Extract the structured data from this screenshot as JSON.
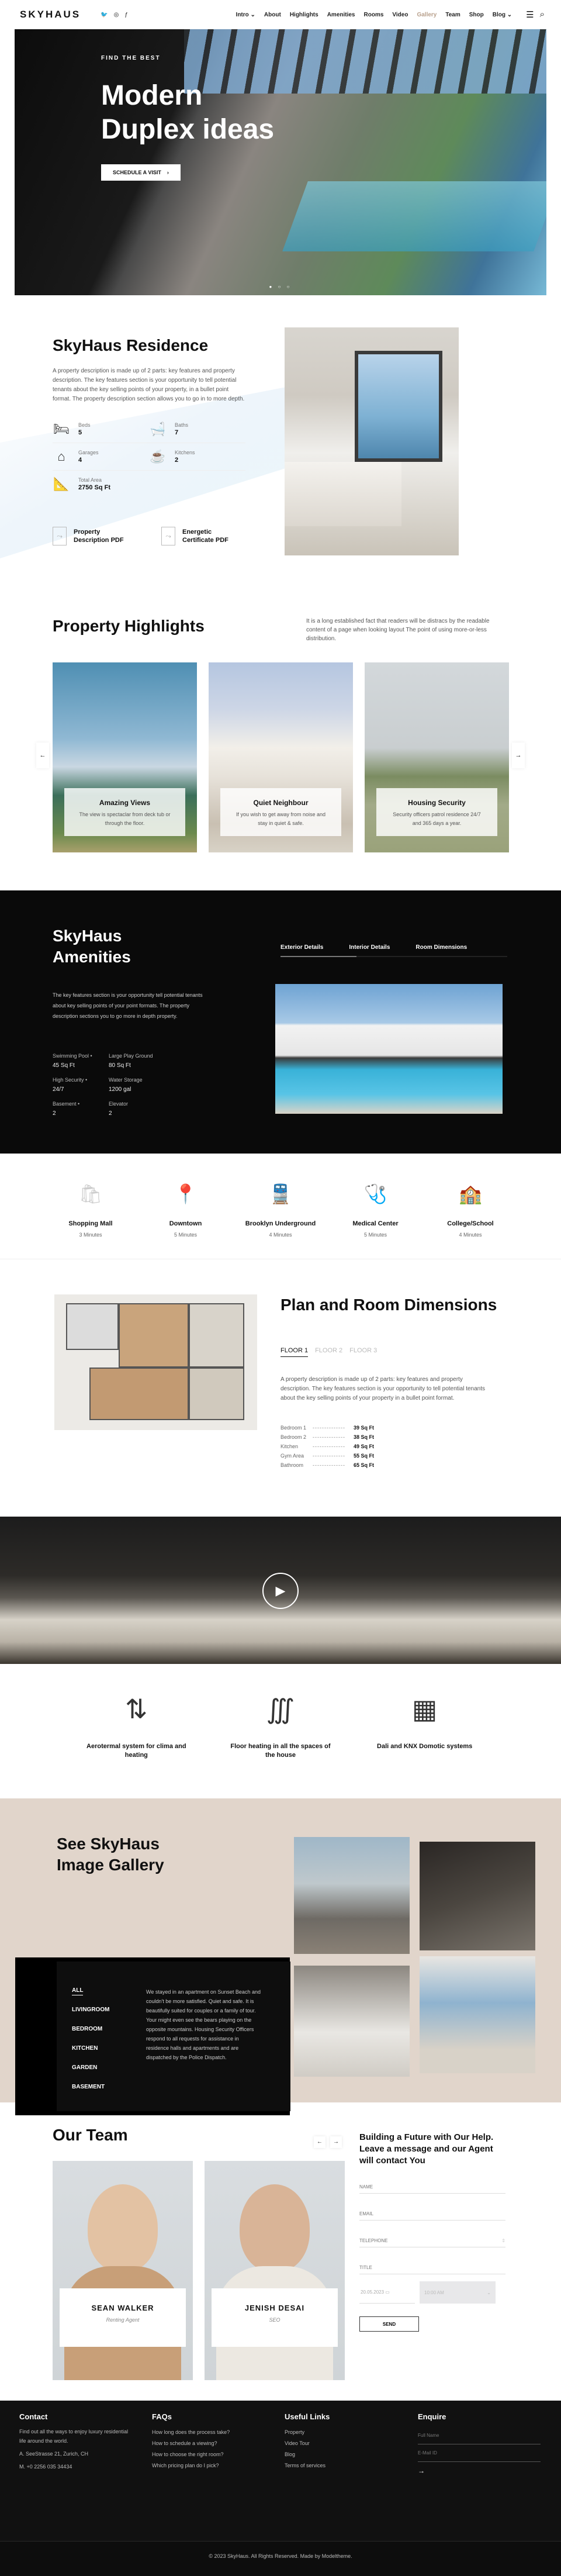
{
  "header": {
    "logo": "SKYHAUS",
    "social": [
      "twitter-icon",
      "instagram-icon",
      "facebook-icon"
    ],
    "nav": [
      {
        "label": "Intro ⌄",
        "active": false
      },
      {
        "label": "About",
        "active": false
      },
      {
        "label": "Highlights",
        "active": false
      },
      {
        "label": "Amenities",
        "active": false
      },
      {
        "label": "Rooms",
        "active": false
      },
      {
        "label": "Video",
        "active": false
      },
      {
        "label": "Gallery",
        "active": true
      },
      {
        "label": "Team",
        "active": false
      },
      {
        "label": "Shop",
        "active": false
      },
      {
        "label": "Blog ⌄",
        "active": false
      }
    ],
    "menu_icon": "☰",
    "search_icon": "⌕"
  },
  "hero": {
    "kicker": "FIND THE BEST",
    "title_line1": "Modern",
    "title_line2": "Duplex ideas",
    "cta": "SCHEDULE A VISIT",
    "cta_arrow": "›",
    "dots": "● ○ ○"
  },
  "residence": {
    "title": "SkyHaus Residence",
    "description": "A property description is made up of 2 parts: key features and property description. The key features section is your opportunity to tell potential tenants about the key selling points of your property, in a bullet point format. The property description section allows you to go in to more depth.",
    "specs": [
      {
        "label": "Beds",
        "value": "5",
        "icon": "🛏"
      },
      {
        "label": "Baths",
        "value": "7",
        "icon": "🛁"
      },
      {
        "label": "Garages",
        "value": "4",
        "icon": "⌂"
      },
      {
        "label": "Kitchens",
        "value": "2",
        "icon": "☕"
      },
      {
        "label": "Total Area",
        "value": "2750 Sq Ft",
        "icon": "📐"
      }
    ],
    "pdfs": [
      {
        "label": "Property Description PDF"
      },
      {
        "label": "Energetic Certificate PDF"
      }
    ]
  },
  "highlights": {
    "title": "Property Highlights",
    "description": "It is a long established fact that readers will be distracs by the readable content of a page when looking layout The point of using more-or-less distribution.",
    "cards": [
      {
        "title": "Amazing Views",
        "text": "The view is spectaclar from deck tub or through the floor."
      },
      {
        "title": "Quiet Neighbour",
        "text": "If you wish to get away from noise and stay in quiet & safe."
      },
      {
        "title": "Housing Security",
        "text": "Security officers patrol residence 24/7 and 365 days a year."
      }
    ],
    "prev": "←",
    "next": "→"
  },
  "amenities": {
    "title": "SkyHaus Amenities",
    "description": "The key features section is your opportunity tell potential tenants about key selling points of your point formats. The property description sections you to go more in depth property.",
    "items": [
      {
        "label": "Swimming Pool •",
        "value": "45 Sq Ft"
      },
      {
        "label": "Large Play Ground",
        "value": "80 Sq Ft"
      },
      {
        "label": "High Security •",
        "value": "24/7"
      },
      {
        "label": "Water Storage",
        "value": "1200 gal"
      },
      {
        "label": "Basement •",
        "value": "2"
      },
      {
        "label": "Elevator",
        "value": "2"
      }
    ],
    "tabs": [
      "Exterior Details",
      "Interior Details",
      "Room Dimensions"
    ],
    "active_tab": "Exterior Details"
  },
  "nearby": [
    {
      "title": "Shopping Mall",
      "time": "3 Minutes",
      "icon": "🛍"
    },
    {
      "title": "Downtown",
      "time": "5 Minutes",
      "icon": "📍"
    },
    {
      "title": "Brooklyn Underground",
      "time": "4 Minutes",
      "icon": "🚆"
    },
    {
      "title": "Medical Center",
      "time": "5 Minutes",
      "icon": "🩺"
    },
    {
      "title": "College/School",
      "time": "4 Minutes",
      "icon": "🏫"
    }
  ],
  "plan": {
    "title": "Plan and Room Dimensions",
    "floors": [
      "FLOOR 1",
      "FLOOR 2",
      "FLOOR 3"
    ],
    "active_floor": "FLOOR 1",
    "description": "A property description is made up of 2 parts: key features and property description. The key features section is your opportunity to tell potential tenants about the key selling points of your property in a bullet point format.",
    "rooms": [
      {
        "name": "Bedroom 1",
        "value": "39 Sq Ft"
      },
      {
        "name": "Bedroom 2",
        "value": "38 Sq Ft"
      },
      {
        "name": "Kitchen",
        "value": "49 Sq Ft"
      },
      {
        "name": "Gym Area",
        "value": "55 Sq Ft"
      },
      {
        "name": "Bathroom",
        "value": "65 Sq Ft"
      }
    ],
    "dashes": "--------------"
  },
  "video": {
    "play_icon": "▶"
  },
  "features": [
    {
      "title": "Aerotermal system for clima and heating",
      "icon": "⇅"
    },
    {
      "title": "Floor heating in all the spaces of the house",
      "icon": "∭"
    },
    {
      "title": "Dali and KNX Domotic systems",
      "icon": "▦"
    }
  ],
  "gallery": {
    "title": "See SkyHaus Image Gallery",
    "categories": [
      "ALL",
      "LIVINGROOM",
      "BEDROOM",
      "KITCHEN",
      "GARDEN",
      "BASEMENT"
    ],
    "active_category": "ALL",
    "quote": "We stayed in an apartment on Sunset Beach and couldn't be more satisfied. Quiet and safe. It is beautifully suited for couples or a family of tour. Your might even see the bears playing on the opposite mountains. Housing Security Officers respond to all requests for assistance in residence halls and apartments and are dispatched by the Police Dispatch."
  },
  "team": {
    "title": "Our Team",
    "prev": "←",
    "next": "→",
    "members": [
      {
        "name": "SEAN WALKER",
        "role": "Renting Agent"
      },
      {
        "name": "JENISH DESAI",
        "role": "SEO"
      }
    ]
  },
  "contact_form": {
    "title": "Building a Future with Our Help. Leave a message and our Agent will contact You",
    "name_placeholder": "NAME",
    "email_placeholder": "EMAIL",
    "phone_placeholder": "TELEPHONE",
    "title_placeholder": "TITLE",
    "date": "20.05.2023",
    "time": "10:00 AM",
    "send": "SEND"
  },
  "footer": {
    "contact_title": "Contact",
    "contact_text": "Find out all the ways to enjoy luxury residential life around the world.",
    "address": "A. SeeStrasse 21, Zurich, CH",
    "phone": "M. +0 2256 035 34434",
    "faq_title": "FAQs",
    "faqs": [
      "How long does the process take?",
      "How to schedule a viewing?",
      "How to choose the right room?",
      "Which pricing plan do I pick?"
    ],
    "links_title": "Useful Links",
    "links": [
      "Property",
      "Video Tour",
      "Blog",
      "Terms of services"
    ],
    "enquire_title": "Enquire",
    "fullname_placeholder": "Full Name",
    "email_placeholder": "E-Mail ID",
    "submit_arrow": "→",
    "copyright": "© 2023 SkyHaus. All Rights Reserved. Made by Modeltheme."
  }
}
